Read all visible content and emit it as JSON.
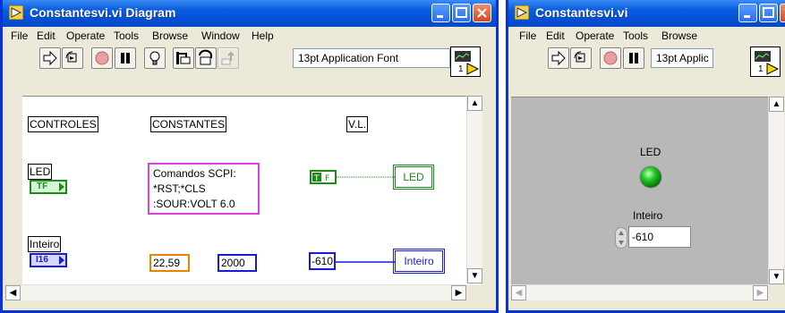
{
  "left_window": {
    "title": "Constantesvi.vi Diagram",
    "menu": [
      "File",
      "Edit",
      "Operate",
      "Tools",
      "Browse",
      "Window",
      "Help"
    ],
    "font_select": "13pt Application Font",
    "vi_icon_number": "1",
    "diagram": {
      "headers": {
        "controles": "CONTROLES",
        "constantes": "CONSTANTES",
        "vl": "V.L."
      },
      "led_label": "LED",
      "led_terminal": "TF",
      "inteiro_label": "Inteiro",
      "inteiro_terminal": "I16",
      "string_constant": [
        "Comandos SCPI:",
        "*RST;*CLS",
        ":SOUR:VOLT 6.0"
      ],
      "num_const_1": "22,59",
      "num_const_2": "2000",
      "num_const_3": "-610",
      "vl_led_label": "LED",
      "vl_inteiro_label": "Inteiro"
    }
  },
  "right_window": {
    "title": "Constantesvi.vi",
    "menu": [
      "File",
      "Edit",
      "Operate",
      "Tools",
      "Browse"
    ],
    "font_select": "13pt Applic",
    "vi_icon_number": "1",
    "panel": {
      "led_label": "LED",
      "led_color": "#22cc22",
      "inteiro_label": "Inteiro",
      "inteiro_value": "-610"
    }
  },
  "colors": {
    "titlebar": "#0a5fe0",
    "boolean_wire": "#1a8c1a",
    "string_wire": "#e040e0",
    "double_wire": "#f08000",
    "integer_wire": "#1a1adb"
  }
}
